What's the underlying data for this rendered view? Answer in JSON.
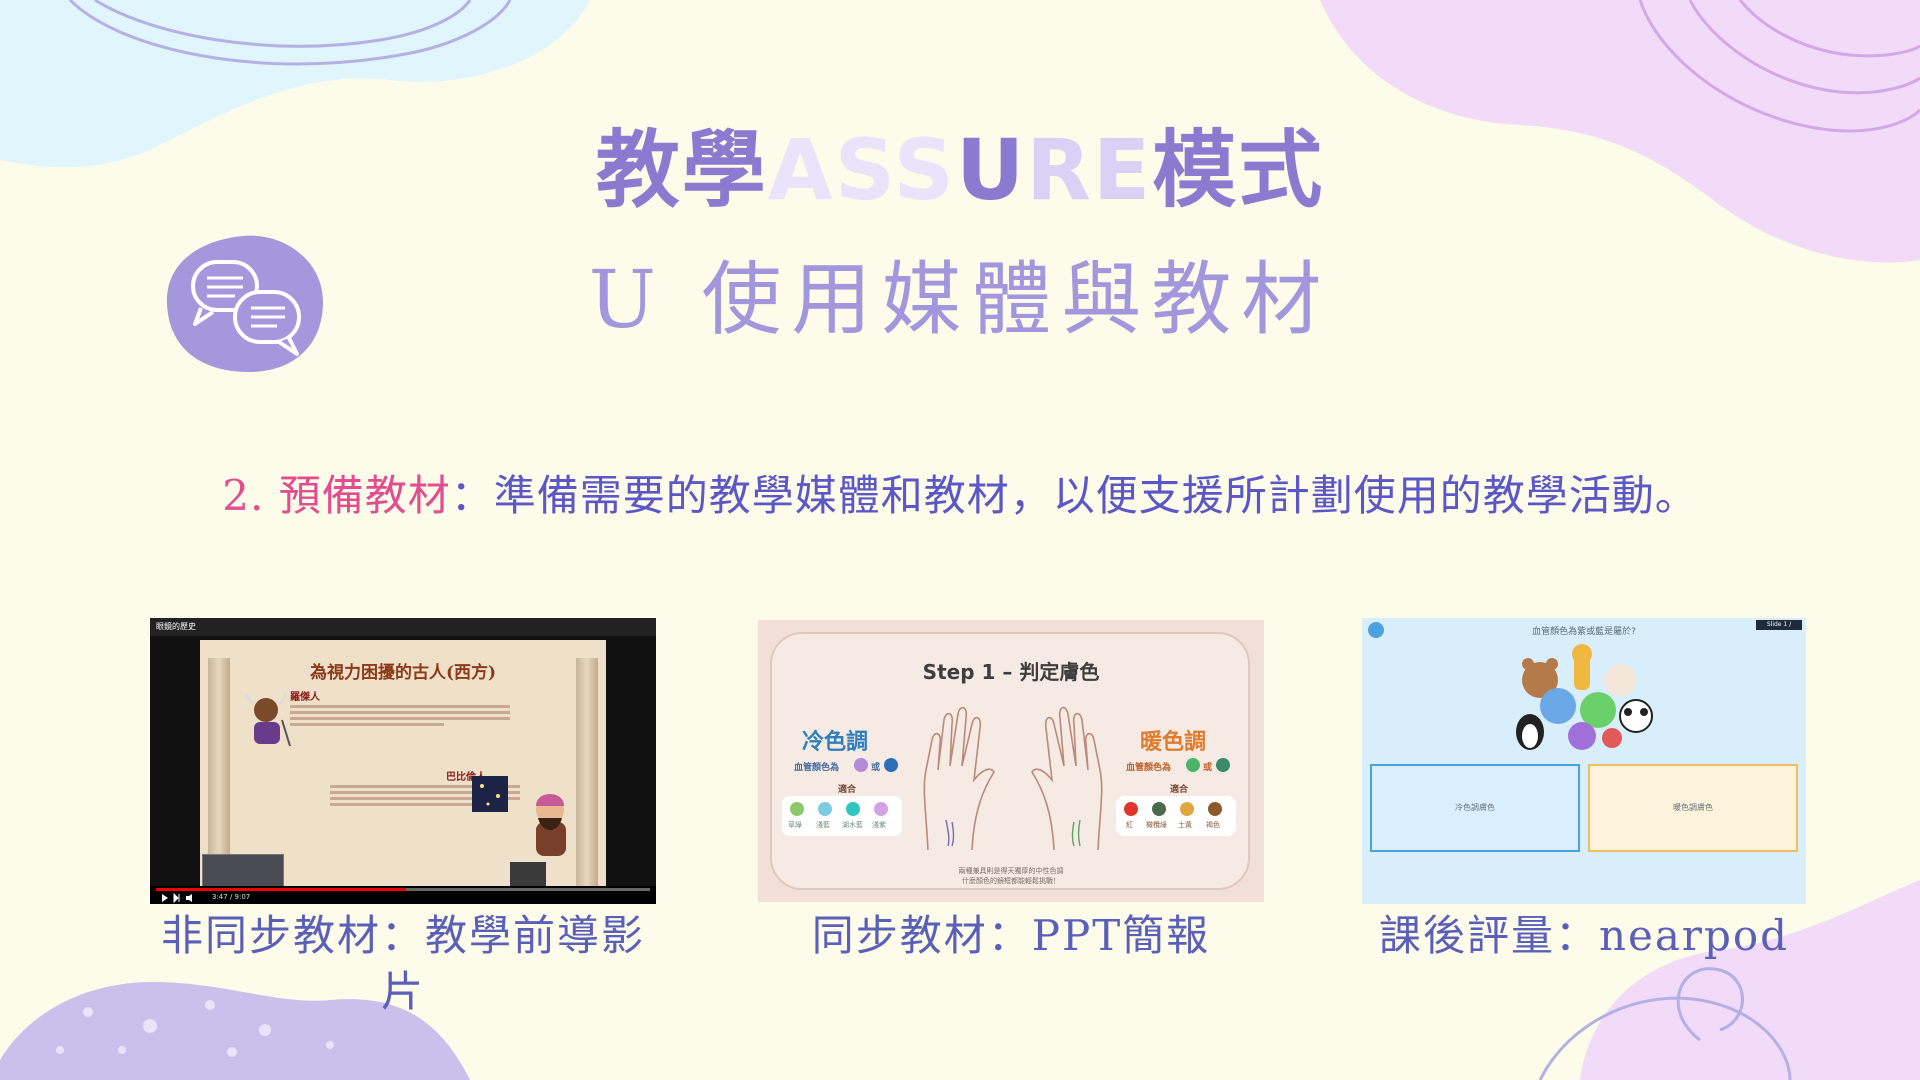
{
  "title": {
    "part1": "教學",
    "assure": [
      "A",
      "S",
      "S",
      "U",
      "R",
      "E"
    ],
    "part2": "模式",
    "subtitle": "U 使用媒體與教材"
  },
  "step": {
    "number": "2.",
    "keyword": "預備教材",
    "colon": "：",
    "text": "準備需要的教學媒體和教材，以便支援所計劃使用的教學活動。"
  },
  "cards": [
    {
      "caption": "非同步教材：教學前導影片",
      "video": {
        "top_title": "眼鏡的歷史",
        "slide_heading": "為視力困擾的古人(西方)",
        "person1": "羅傑人",
        "person2": "巴比倫人",
        "time": "3:47 / 9:07"
      }
    },
    {
      "caption": "同步教材：PPT簡報",
      "ppt": {
        "heading": "Step 1 – 判定膚色",
        "cool": "冷色調",
        "warm": "暖色調",
        "cool_vein": "血管顏色為",
        "warm_vein": "血管顏色為",
        "or": "或",
        "suit": "適合",
        "cool_colors": [
          "草綠",
          "淺藍",
          "湖水藍",
          "淺紫"
        ],
        "warm_colors": [
          "紅",
          "橄欖綠",
          "土黃",
          "褐色"
        ],
        "note1": "兩種兼具則是得天獨厚的中性色調",
        "note2": "什麼顏色的鏡框都能輕鬆挑戰！"
      }
    },
    {
      "caption": "課後評量：nearpod",
      "nearpod": {
        "question": "血管顏色為紫或藍是屬於?",
        "slide": "Slide 1 /",
        "option1": "冷色調膚色",
        "option2": "暖色調膚色"
      }
    }
  ]
}
